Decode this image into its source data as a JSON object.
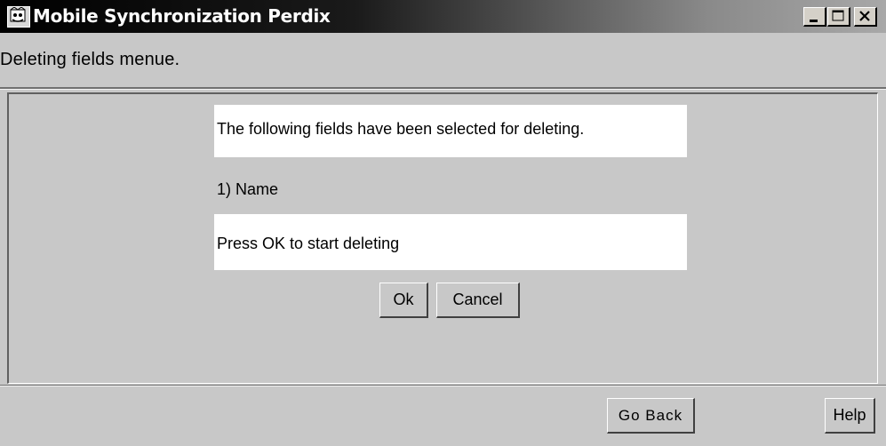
{
  "window": {
    "title": "Mobile Synchronization Perdix",
    "app_icon": "app-icon",
    "controls": [
      "minimize-icon",
      "maximize-icon",
      "close-icon"
    ]
  },
  "header": {
    "subtitle": "Deleting fields menue."
  },
  "dialog": {
    "intro": "The following fields have been selected for deleting.",
    "fields": [
      "1) Name"
    ],
    "instruction": "Press OK to start deleting",
    "ok_label": "Ok",
    "cancel_label": "Cancel"
  },
  "footer": {
    "go_back_label": "Go Back",
    "help_label": "Help"
  }
}
